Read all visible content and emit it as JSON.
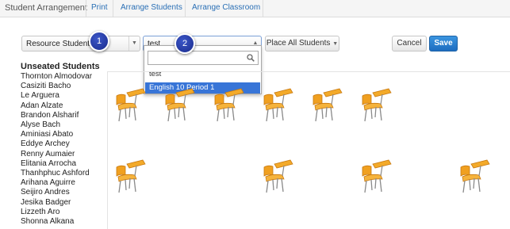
{
  "topbar": {
    "brand": "Student Arrangement",
    "nav": [
      "Print",
      "Arrange Students",
      "Arrange Classroom"
    ]
  },
  "toolbar": {
    "group_select_value": "Resource Students",
    "class_select_value": "test",
    "place_all_label": "Place All Students",
    "cancel_label": "Cancel",
    "save_label": "Save"
  },
  "dropdown": {
    "search_value": "",
    "options": [
      {
        "label": "test",
        "selected": false
      },
      {
        "label": "English 10 Period 1",
        "selected": true
      }
    ]
  },
  "callouts": [
    "1",
    "2"
  ],
  "sidebar": {
    "title": "Unseated Students",
    "students": [
      "Thornton Almodovar",
      "Casiziti Bacho",
      "Le Arguera",
      "Adan Alzate",
      "Brandon Alsharif",
      "Alyse Bach",
      "Aminiasi Abato",
      "Eddye Archey",
      "Renny Aumaier",
      "Elitania Arrocha",
      "Thanhphuc Ashford",
      "Arihana Aguirre",
      "Seijiro Andres",
      "Jesika Badger",
      "Lizzeth Aro",
      "Shonna Alkana"
    ]
  },
  "classroom": {
    "desk_count": 10,
    "colors": {
      "seat": "#f0a020",
      "seat_dark": "#c97a10",
      "legs": "#8a8a8a"
    }
  }
}
